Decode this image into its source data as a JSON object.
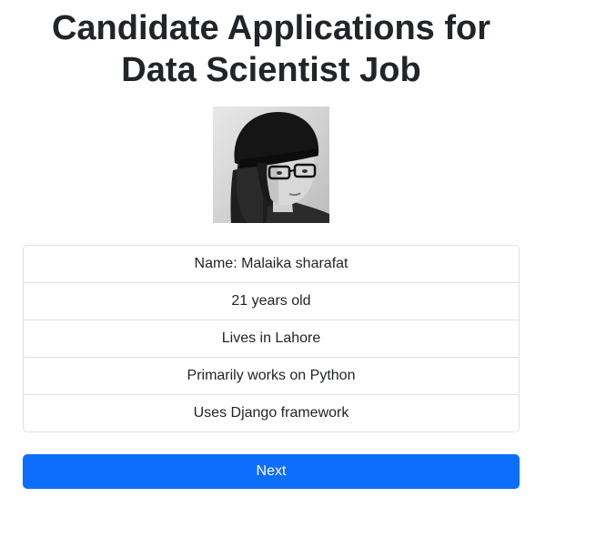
{
  "page": {
    "title": "Candidate Applications for\nData Scientist Job"
  },
  "candidate": {
    "photo_icon": "candidate-photo",
    "details": [
      "Name: Malaika sharafat",
      "21 years old",
      "Lives in Lahore",
      "Primarily works on Python",
      "Uses Django framework"
    ]
  },
  "actions": {
    "next_label": "Next"
  },
  "colors": {
    "primary": "#0d6efd",
    "text": "#212529",
    "border": "#dee2e6"
  }
}
